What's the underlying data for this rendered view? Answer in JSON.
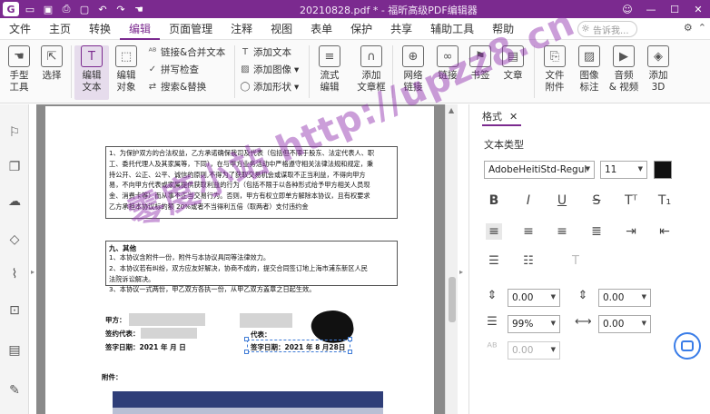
{
  "app": {
    "logo": "G",
    "window_title": "20210828.pdf * - 福昕高级PDF编辑器",
    "win_buttons": [
      "☺",
      "—",
      "☐",
      "✕"
    ]
  },
  "menu": {
    "items": [
      "文件",
      "主页",
      "转换",
      "编辑",
      "页面管理",
      "注释",
      "视图",
      "表单",
      "保护",
      "共享",
      "辅助工具",
      "帮助"
    ],
    "active": "编辑",
    "search_placeholder": "告诉我..."
  },
  "ribbon": {
    "hand_tool": "手型\n工具",
    "select": "选择",
    "edit_text": "编辑\n文本",
    "edit_object": "编辑\n对象",
    "link_merge_text": "链接&合并文本",
    "spell_check": "拼写检查",
    "search_replace": "搜索&替换",
    "add_text": "添加文本",
    "add_image": "添加图像",
    "add_shape": "添加形状",
    "flow_edit": "流式\n编辑",
    "add_textbox": "添加\n文章框",
    "web_link": "网络\n链接",
    "link": "链接",
    "bookmark": "书签",
    "article": "文章",
    "file_attachment": "文件\n附件",
    "image_annotation": "图像\n标注",
    "audio_video": "音频\n& 视频",
    "add_3d": "添加\n3D"
  },
  "document": {
    "para1": "1、为保护双方的合法权益，乙方承诺确保我司及代表（包括但不限于股东、法定代表人、职\n工、委托代理人及其家属等，下同），在与甲方业务活动中严格遵守相关法律法规和规定，秉\n持公开、公正、公平、诚信的原则,不得为了获取交易机会或谋取不正当利益，不得向甲方\n易，不向甲方代表或家属提供获取利益的行为（包括不限于以各种形式给予甲方相关人员现\n金、消费卡等）而从事不正当交易行为。否则，甲方有权立即单方解除本协议，且有权要求\n乙方承担本协议标的额 20%或者不当得利五倍（取两者）支付违约金",
    "sec9_title": "九、其他",
    "sec9_text": "1、本协议含附件一份，附件与本协议具同等法律效力。\n2、本协议若有纠纷，双方应友好解决，协商不成的，提交合同签订地上海市浦东新区人民\n法院诉讼解决。\n3、本协议一式两份，甲乙双方各执一份，从甲乙双方盖章之日起生效。",
    "party_a": "甲方：",
    "signer_rep": "签约代表：",
    "sign_date_a": "签字日期：2021 年    月    日",
    "party_b_rep": "代表：",
    "sign_date_b": "签字日期：2021 年 8 月28日",
    "attachment": "附件："
  },
  "panel": {
    "tab_label": "格式",
    "section_title": "文本类型",
    "font_name": "AdobeHeitiStd-Regul",
    "font_size": "11",
    "text_color": "#111111",
    "line_spacing": "0.00",
    "para_spacing": "0.00",
    "scale": "99%",
    "char_spacing": "0.00",
    "baseline": "0.00"
  },
  "watermark": "零度小站 http://upzz8.cn"
}
